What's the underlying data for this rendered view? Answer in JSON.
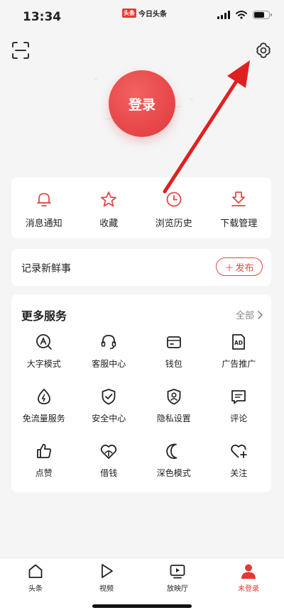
{
  "status_bar": {
    "time": "13:34",
    "app_logo": "头条",
    "app_name": "今日头条",
    "battery_level": 0.75
  },
  "header": {
    "scan_icon": "scan-icon",
    "settings_icon": "gear-icon"
  },
  "login": {
    "label": "登录"
  },
  "quick_actions": [
    {
      "label": "消息通知",
      "icon": "bell-icon"
    },
    {
      "label": "收藏",
      "icon": "star-icon"
    },
    {
      "label": "浏览历史",
      "icon": "clock-icon"
    },
    {
      "label": "下载管理",
      "icon": "download-icon"
    }
  ],
  "post": {
    "label": "记录新鲜事",
    "button": "发布"
  },
  "services": {
    "title": "更多服务",
    "all": "全部",
    "items": [
      {
        "label": "大字模式",
        "icon": "large-font-icon"
      },
      {
        "label": "客服中心",
        "icon": "headset-icon"
      },
      {
        "label": "钱包",
        "icon": "wallet-icon"
      },
      {
        "label": "广告推广",
        "icon": "ad-icon"
      },
      {
        "label": "免流量服务",
        "icon": "data-free-icon"
      },
      {
        "label": "安全中心",
        "icon": "shield-icon"
      },
      {
        "label": "隐私设置",
        "icon": "privacy-icon"
      },
      {
        "label": "评论",
        "icon": "comment-icon"
      },
      {
        "label": "点赞",
        "icon": "thumbs-up-icon"
      },
      {
        "label": "借钱",
        "icon": "loan-icon"
      },
      {
        "label": "深色模式",
        "icon": "moon-icon"
      },
      {
        "label": "关注",
        "icon": "heart-plus-icon"
      }
    ]
  },
  "tabs": [
    {
      "label": "头条",
      "icon": "home-icon"
    },
    {
      "label": "视频",
      "icon": "play-icon"
    },
    {
      "label": "放映厅",
      "icon": "tv-icon"
    },
    {
      "label": "未登录",
      "icon": "user-icon",
      "active": true
    }
  ],
  "colors": {
    "accent": "#e53935",
    "background": "#f5f5f5",
    "card": "#ffffff"
  }
}
